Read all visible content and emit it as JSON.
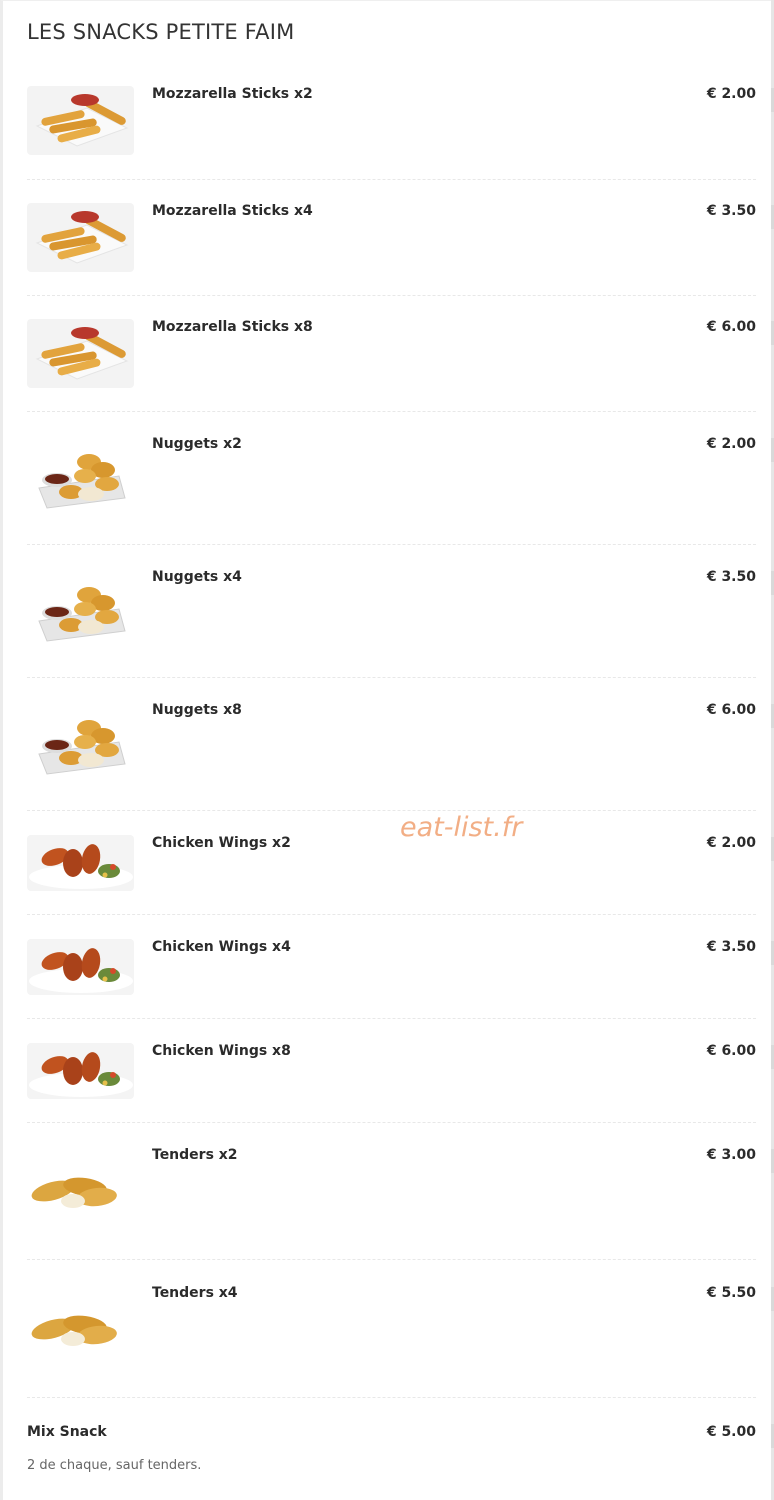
{
  "section": {
    "title": "LES SNACKS PETITE FAIM"
  },
  "items": [
    {
      "name": "Mozzarella Sticks x2",
      "price": "€ 2.00",
      "image": "mozzarella-sticks-image"
    },
    {
      "name": "Mozzarella Sticks x4",
      "price": "€ 3.50",
      "image": "mozzarella-sticks-image"
    },
    {
      "name": "Mozzarella Sticks x8",
      "price": "€ 6.00",
      "image": "mozzarella-sticks-image"
    },
    {
      "name": "Nuggets x2",
      "price": "€ 2.00",
      "image": "nuggets-image"
    },
    {
      "name": "Nuggets x4",
      "price": "€ 3.50",
      "image": "nuggets-image"
    },
    {
      "name": "Nuggets x8",
      "price": "€ 6.00",
      "image": "nuggets-image"
    },
    {
      "name": "Chicken Wings x2",
      "price": "€ 2.00",
      "image": "chicken-wings-image"
    },
    {
      "name": "Chicken Wings x4",
      "price": "€ 3.50",
      "image": "chicken-wings-image"
    },
    {
      "name": "Chicken Wings x8",
      "price": "€ 6.00",
      "image": "chicken-wings-image"
    },
    {
      "name": "Tenders x2",
      "price": "€ 3.00",
      "image": "tenders-image"
    },
    {
      "name": "Tenders x4",
      "price": "€ 5.50",
      "image": "tenders-image"
    }
  ],
  "mix": {
    "name": "Mix Snack",
    "price": "€ 5.00",
    "description": "2 de chaque, sauf tenders."
  },
  "watermark": "eat-list.fr",
  "colors": {
    "watermark": "#f0a070",
    "text": "#2b2b2b",
    "divider": "#e8e8e8"
  }
}
